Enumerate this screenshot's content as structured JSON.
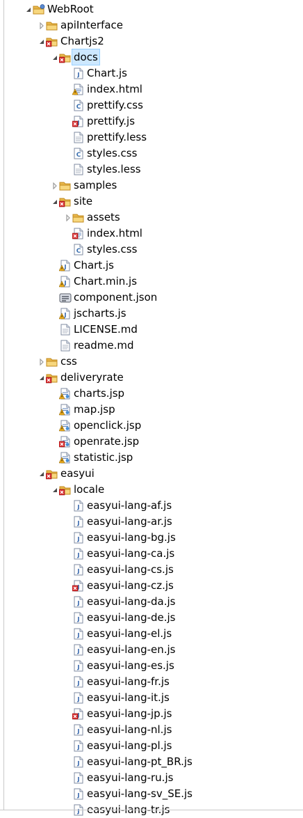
{
  "tree": [
    {
      "label": "WebRoot",
      "type": "project",
      "state": "expanded",
      "depth": 0
    },
    {
      "label": "apiInterface",
      "type": "folder",
      "state": "collapsed",
      "depth": 1
    },
    {
      "label": "Chartjs2",
      "type": "folder-error",
      "state": "expanded",
      "depth": 1
    },
    {
      "label": "docs",
      "type": "folder-error",
      "state": "expanded",
      "depth": 2,
      "selected": true
    },
    {
      "label": "Chart.js",
      "type": "js",
      "depth": 3
    },
    {
      "label": "index.html",
      "type": "html-warning",
      "depth": 3
    },
    {
      "label": "prettify.css",
      "type": "css",
      "depth": 3
    },
    {
      "label": "prettify.js",
      "type": "js-error",
      "depth": 3
    },
    {
      "label": "prettify.less",
      "type": "text",
      "depth": 3
    },
    {
      "label": "styles.css",
      "type": "css",
      "depth": 3
    },
    {
      "label": "styles.less",
      "type": "text",
      "depth": 3
    },
    {
      "label": "samples",
      "type": "folder",
      "state": "collapsed",
      "depth": 2
    },
    {
      "label": "site",
      "type": "folder-error",
      "state": "expanded",
      "depth": 2
    },
    {
      "label": "assets",
      "type": "folder",
      "state": "collapsed",
      "depth": 3
    },
    {
      "label": "index.html",
      "type": "html-error",
      "depth": 3
    },
    {
      "label": "styles.css",
      "type": "css",
      "depth": 3
    },
    {
      "label": "Chart.js",
      "type": "js-warning",
      "depth": 2
    },
    {
      "label": "Chart.min.js",
      "type": "js-warning",
      "depth": 2
    },
    {
      "label": "component.json",
      "type": "json",
      "depth": 2
    },
    {
      "label": "jscharts.js",
      "type": "js-warning",
      "depth": 2
    },
    {
      "label": "LICENSE.md",
      "type": "text",
      "depth": 2
    },
    {
      "label": "readme.md",
      "type": "text",
      "depth": 2
    },
    {
      "label": "css",
      "type": "folder",
      "state": "collapsed",
      "depth": 1
    },
    {
      "label": "deliveryrate",
      "type": "folder-error",
      "state": "expanded",
      "depth": 1
    },
    {
      "label": "charts.jsp",
      "type": "jsp-warning",
      "depth": 2
    },
    {
      "label": "map.jsp",
      "type": "jsp-warning",
      "depth": 2
    },
    {
      "label": "openclick.jsp",
      "type": "jsp-warning",
      "depth": 2
    },
    {
      "label": "openrate.jsp",
      "type": "jsp-error",
      "depth": 2
    },
    {
      "label": "statistic.jsp",
      "type": "jsp-warning",
      "depth": 2
    },
    {
      "label": "easyui",
      "type": "folder-error",
      "state": "expanded",
      "depth": 1
    },
    {
      "label": "locale",
      "type": "folder-error",
      "state": "expanded",
      "depth": 2
    },
    {
      "label": "easyui-lang-af.js",
      "type": "js",
      "depth": 3
    },
    {
      "label": "easyui-lang-ar.js",
      "type": "js",
      "depth": 3
    },
    {
      "label": "easyui-lang-bg.js",
      "type": "js",
      "depth": 3
    },
    {
      "label": "easyui-lang-ca.js",
      "type": "js",
      "depth": 3
    },
    {
      "label": "easyui-lang-cs.js",
      "type": "js",
      "depth": 3
    },
    {
      "label": "easyui-lang-cz.js",
      "type": "js-error",
      "depth": 3
    },
    {
      "label": "easyui-lang-da.js",
      "type": "js",
      "depth": 3
    },
    {
      "label": "easyui-lang-de.js",
      "type": "js",
      "depth": 3
    },
    {
      "label": "easyui-lang-el.js",
      "type": "js",
      "depth": 3
    },
    {
      "label": "easyui-lang-en.js",
      "type": "js",
      "depth": 3
    },
    {
      "label": "easyui-lang-es.js",
      "type": "js",
      "depth": 3
    },
    {
      "label": "easyui-lang-fr.js",
      "type": "js",
      "depth": 3
    },
    {
      "label": "easyui-lang-it.js",
      "type": "js",
      "depth": 3
    },
    {
      "label": "easyui-lang-jp.js",
      "type": "js-error",
      "depth": 3
    },
    {
      "label": "easyui-lang-nl.js",
      "type": "js",
      "depth": 3
    },
    {
      "label": "easyui-lang-pl.js",
      "type": "js",
      "depth": 3
    },
    {
      "label": "easyui-lang-pt_BR.js",
      "type": "js",
      "depth": 3
    },
    {
      "label": "easyui-lang-ru.js",
      "type": "js",
      "depth": 3
    },
    {
      "label": "easyui-lang-sv_SE.js",
      "type": "js",
      "depth": 3
    },
    {
      "label": "easyui-lang-tr.js",
      "type": "js",
      "depth": 3
    }
  ],
  "colors": {
    "folder": "#e8b64a",
    "folder_dark": "#c18a1e",
    "error": "#d8282a",
    "warning": "#f2b01e",
    "js_blue": "#2c5fa8",
    "selection_bg": "#cde8ff",
    "selection_border": "#99d1ff"
  }
}
